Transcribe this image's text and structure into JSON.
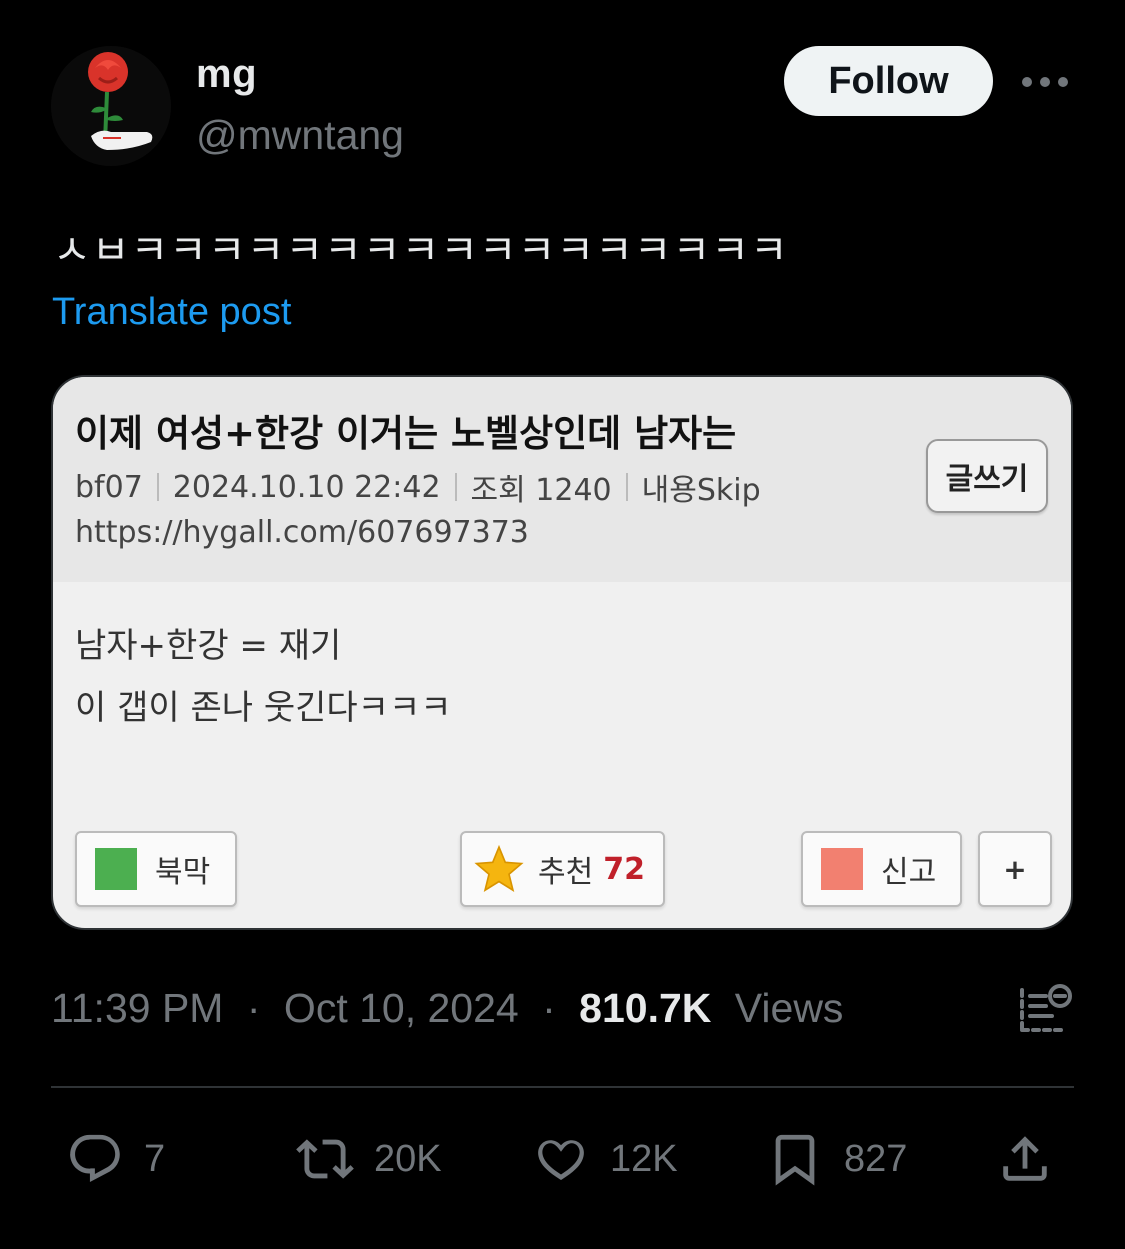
{
  "author": {
    "display_name": "mg",
    "handle": "@mwntang",
    "follow_label": "Follow"
  },
  "post": {
    "text": "ㅅㅂㅋㅋㅋㅋㅋㅋㅋㅋㅋㅋㅋㅋㅋㅋㅋㅋㅋ",
    "translate_label": "Translate post"
  },
  "embedded_image": {
    "title": "이제 여성+한강 이거는 노벨상인데 남자는",
    "author": "bf07",
    "datetime": "2024.10.10 22:42",
    "views": "조회 1240",
    "skip": "내용Skip",
    "url": "https://hygall.com/607697373",
    "write_button": "글쓰기",
    "body_lines": [
      "남자+한강 = 재기",
      "이 갭이 존나 웃긴다ㅋㅋㅋ"
    ],
    "bookmark_label": "북막",
    "recommend_label": "추천",
    "recommend_count": "72",
    "report_label": "신고",
    "plus_label": "+"
  },
  "meta": {
    "time": "11:39 PM",
    "date": "Oct 10, 2024",
    "dot": "·",
    "views_count": "810.7K",
    "views_label": "Views"
  },
  "actions": {
    "replies": "7",
    "reposts": "20K",
    "likes": "12K",
    "bookmarks": "827"
  },
  "colors": {
    "background": "#000000",
    "text_primary": "#e7e9ea",
    "text_secondary": "#71767b",
    "link": "#1d9bf0",
    "follow_bg": "#eff3f4"
  }
}
